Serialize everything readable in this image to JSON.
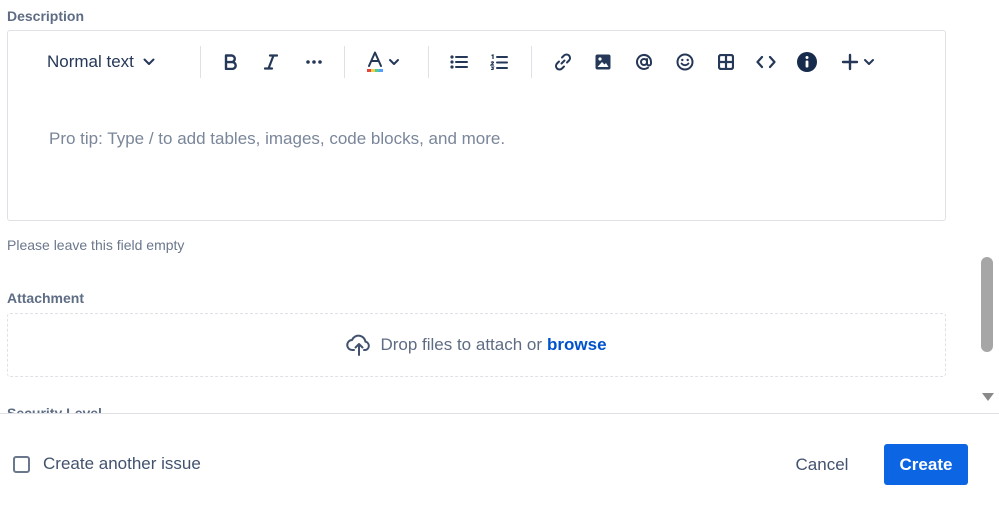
{
  "description": {
    "label": "Description",
    "toolbar": {
      "text_style": "Normal text",
      "icons": [
        "bold-icon",
        "italic-icon",
        "more-formatting-icon",
        "text-color-icon",
        "bullet-list-icon",
        "numbered-list-icon",
        "link-icon",
        "image-icon",
        "mention-icon",
        "emoji-icon",
        "table-icon",
        "code-icon",
        "info-icon",
        "insert-plus-icon"
      ]
    },
    "placeholder": "Pro tip: Type / to add tables, images, code blocks, and more.",
    "helper": "Please leave this field empty"
  },
  "attachment": {
    "label": "Attachment",
    "drop_text": "Drop files to attach or",
    "browse": "browse"
  },
  "security": {
    "label": "Security Level"
  },
  "footer": {
    "create_another": "Create another issue",
    "cancel": "Cancel",
    "create": "Create"
  },
  "colors": {
    "primary": "#0c66e4",
    "link": "#0052cc",
    "border": "#dfe1e6"
  }
}
